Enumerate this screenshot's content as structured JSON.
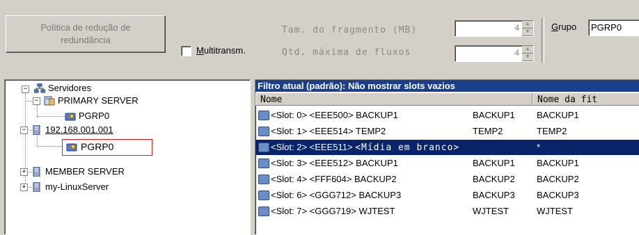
{
  "toolbar": {
    "policy_button": "Política de redução de\nredundância",
    "multitransm_label": "Multitransm.",
    "multitransm_checked": false,
    "frag_label": "Tam. do fragmento (MB)",
    "frag_value": "4",
    "maxflows_label": "Qtd. máxima de fluxos",
    "maxflows_value": "4",
    "grupo_label": "Grupo",
    "grupo_value": "PGRP0"
  },
  "tree": {
    "root": "Servidores",
    "nodes": [
      {
        "label": "PRIMARY SERVER",
        "icon": "server-icon",
        "expanded": true
      },
      {
        "label": "PGRP0",
        "icon": "group-icon"
      },
      {
        "label": "192.168.001.001",
        "icon": "server-icon",
        "expanded": true
      },
      {
        "label": "PGRP0",
        "icon": "group-icon",
        "selected": true
      },
      {
        "label": "MEMBER SERVER",
        "icon": "server-icon",
        "expanded": false
      },
      {
        "label": "my-LinuxServer",
        "icon": "server-icon",
        "expanded": false
      }
    ]
  },
  "list": {
    "filter": "Filtro atual (padrão):  Não mostrar slots vazios",
    "columns": [
      "Nome",
      "Nome da fit"
    ],
    "rows": [
      {
        "slot": "<Slot: 0>",
        "barcode": "<EEE500>",
        "name": "BACKUP1",
        "c2": "BACKUP1",
        "c3": "BACKUP1"
      },
      {
        "slot": "<Slot: 1>",
        "barcode": "<EEE514>",
        "name": "TEMP2",
        "c2": "TEMP2",
        "c3": "TEMP2"
      },
      {
        "slot": "<Slot: 2>",
        "barcode": "<EEE511>",
        "name": "<Mídia em branco>",
        "c2": "",
        "c3": "*",
        "selected": true
      },
      {
        "slot": "<Slot: 3>",
        "barcode": "<EEE512>",
        "name": "BACKUP1",
        "c2": "BACKUP1",
        "c3": "BACKUP1"
      },
      {
        "slot": "<Slot: 4>",
        "barcode": "<FFF604>",
        "name": "BACKUP2",
        "c2": "BACKUP2",
        "c3": "BACKUP2"
      },
      {
        "slot": "<Slot: 6>",
        "barcode": "<GGG712>",
        "name": "BACKUP3",
        "c2": "BACKUP3",
        "c3": "BACKUP3"
      },
      {
        "slot": "<Slot: 7>",
        "barcode": "<GGG719>",
        "name": "WJTEST",
        "c2": "WJTEST",
        "c3": "WJTEST"
      }
    ]
  }
}
